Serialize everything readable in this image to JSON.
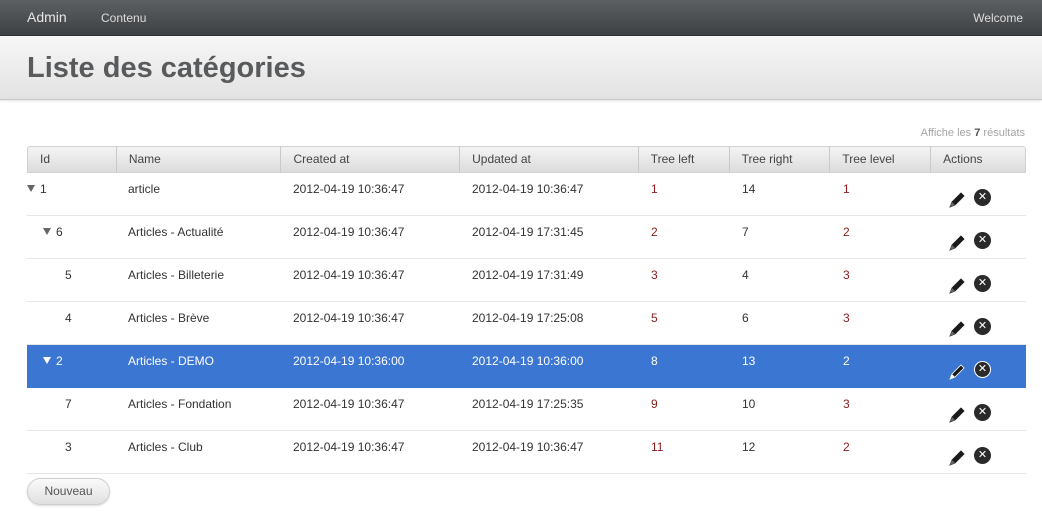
{
  "nav": {
    "brand": "Admin",
    "menu_item": "Contenu",
    "welcome": "Welcome"
  },
  "page": {
    "title": "Liste des catégories"
  },
  "results": {
    "prefix": "Affiche les",
    "count": "7",
    "suffix": "résultats"
  },
  "table": {
    "columns": [
      "Id",
      "Name",
      "Created at",
      "Updated at",
      "Tree left",
      "Tree right",
      "Tree level",
      "Actions"
    ],
    "rows": [
      {
        "id": "1",
        "name": "article",
        "created": "2012-04-19 10:36:47",
        "updated": "2012-04-19 10:36:47",
        "tree_left": "1",
        "tree_right": "14",
        "tree_level": "1",
        "depth": 0,
        "has_children": true,
        "selected": false
      },
      {
        "id": "6",
        "name": "Articles - Actualité",
        "created": "2012-04-19 10:36:47",
        "updated": "2012-04-19 17:31:45",
        "tree_left": "2",
        "tree_right": "7",
        "tree_level": "2",
        "depth": 1,
        "has_children": true,
        "selected": false
      },
      {
        "id": "5",
        "name": "Articles - Billeterie",
        "created": "2012-04-19 10:36:47",
        "updated": "2012-04-19 17:31:49",
        "tree_left": "3",
        "tree_right": "4",
        "tree_level": "3",
        "depth": 2,
        "has_children": false,
        "selected": false
      },
      {
        "id": "4",
        "name": "Articles - Brève",
        "created": "2012-04-19 10:36:47",
        "updated": "2012-04-19 17:25:08",
        "tree_left": "5",
        "tree_right": "6",
        "tree_level": "3",
        "depth": 2,
        "has_children": false,
        "selected": false
      },
      {
        "id": "2",
        "name": "Articles - DEMO",
        "created": "2012-04-19 10:36:00",
        "updated": "2012-04-19 10:36:00",
        "tree_left": "8",
        "tree_right": "13",
        "tree_level": "2",
        "depth": 1,
        "has_children": true,
        "selected": true
      },
      {
        "id": "7",
        "name": "Articles - Fondation",
        "created": "2012-04-19 10:36:47",
        "updated": "2012-04-19 17:25:35",
        "tree_left": "9",
        "tree_right": "10",
        "tree_level": "3",
        "depth": 2,
        "has_children": false,
        "selected": false
      },
      {
        "id": "3",
        "name": "Articles - Club",
        "created": "2012-04-19 10:36:47",
        "updated": "2012-04-19 10:36:47",
        "tree_left": "11",
        "tree_right": "12",
        "tree_level": "2",
        "depth": 2,
        "has_children": false,
        "selected": false
      }
    ],
    "row_icons": {
      "edit": "pencil-icon",
      "delete": "close-circle-icon"
    }
  },
  "buttons": {
    "new_label": "Nouveau"
  },
  "colors": {
    "selected_row": "#3b76d3",
    "topbar": "#4a4d50",
    "numeric_text": "#8a1c1c"
  }
}
